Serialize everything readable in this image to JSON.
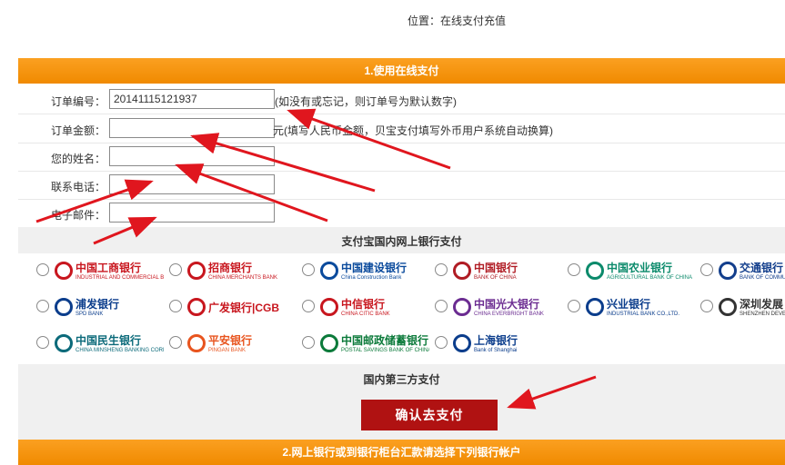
{
  "location_text": "位置：在线支付充值",
  "section1_title": "1.使用在线支付",
  "form": {
    "order_no_label": "订单编号：",
    "order_no_value": "20141115121937",
    "order_no_hint": "(如没有或忘记，则订单号为默认数字)",
    "amount_label": "订单金额：",
    "amount_value": "",
    "amount_hint": "元(填写人民币金额，贝宝支付填写外币用户系统自动换算)",
    "name_label": "您的姓名：",
    "name_value": "",
    "phone_label": "联系电话：",
    "phone_value": "",
    "email_label": "电子邮件：",
    "email_value": ""
  },
  "bank_section_title": "支付宝国内网上银行支付",
  "banks": [
    {
      "name": "中国工商银行",
      "sub": "INDUSTRIAL AND COMMERCIAL BANK OF CHINA",
      "color": "#c8161e",
      "icon": "icbc-logo"
    },
    {
      "name": "招商银行",
      "sub": "CHINA MERCHANTS BANK",
      "color": "#c8161e",
      "icon": "cmb-logo"
    },
    {
      "name": "中国建设银行",
      "sub": "China Construction Bank",
      "color": "#0a4a9c",
      "icon": "ccb-logo"
    },
    {
      "name": "中国银行",
      "sub": "BANK OF CHINA",
      "color": "#b01c24",
      "icon": "boc-logo"
    },
    {
      "name": "中国农业银行",
      "sub": "AGRICULTURAL BANK OF CHINA",
      "color": "#0b8a6b",
      "icon": "abc-logo"
    },
    {
      "name": "交通银行",
      "sub": "BANK OF COMMUNICATIONS",
      "color": "#123e8c",
      "icon": "bocom-logo"
    },
    {
      "name": "浦发银行",
      "sub": "SPD BANK",
      "color": "#0b3d8c",
      "icon": "spdb-logo"
    },
    {
      "name": "广发银行|CGB",
      "sub": "",
      "color": "#c8161e",
      "icon": "cgb-logo"
    },
    {
      "name": "中信银行",
      "sub": "CHINA CITIC BANK",
      "color": "#c8161e",
      "icon": "citic-logo"
    },
    {
      "name": "中国光大银行",
      "sub": "CHINA EVERBRIGHT BANK",
      "color": "#6b2c91",
      "icon": "ceb-logo"
    },
    {
      "name": "兴业银行",
      "sub": "INDUSTRIAL BANK CO.,LTD.",
      "color": "#0b3d8c",
      "icon": "cib-logo"
    },
    {
      "name": "深圳发展",
      "sub": "SHENZHEN DEVELOPMENT",
      "color": "#333333",
      "icon": "sdb-logo"
    },
    {
      "name": "中国民生银行",
      "sub": "CHINA MINSHENG BANKING CORP.,LTD",
      "color": "#0b6a7a",
      "icon": "cmbc-logo"
    },
    {
      "name": "平安银行",
      "sub": "PINGAN BANK",
      "color": "#e8541e",
      "icon": "pingan-logo"
    },
    {
      "name": "中国邮政储蓄银行",
      "sub": "POSTAL SAVINGS BANK OF CHINA",
      "color": "#0b7a3a",
      "icon": "psbc-logo"
    },
    {
      "name": "上海银行",
      "sub": "Bank of Shanghai",
      "color": "#0b3d8c",
      "icon": "bosh-logo"
    }
  ],
  "third_party_title": "国内第三方支付",
  "pay_button": "确认去支付",
  "section2_title": "2.网上银行或到银行柜台汇款请选择下列银行帐户",
  "colors": {
    "accent": "#f39200",
    "button": "#b01212",
    "arrow": "#e0161e"
  }
}
